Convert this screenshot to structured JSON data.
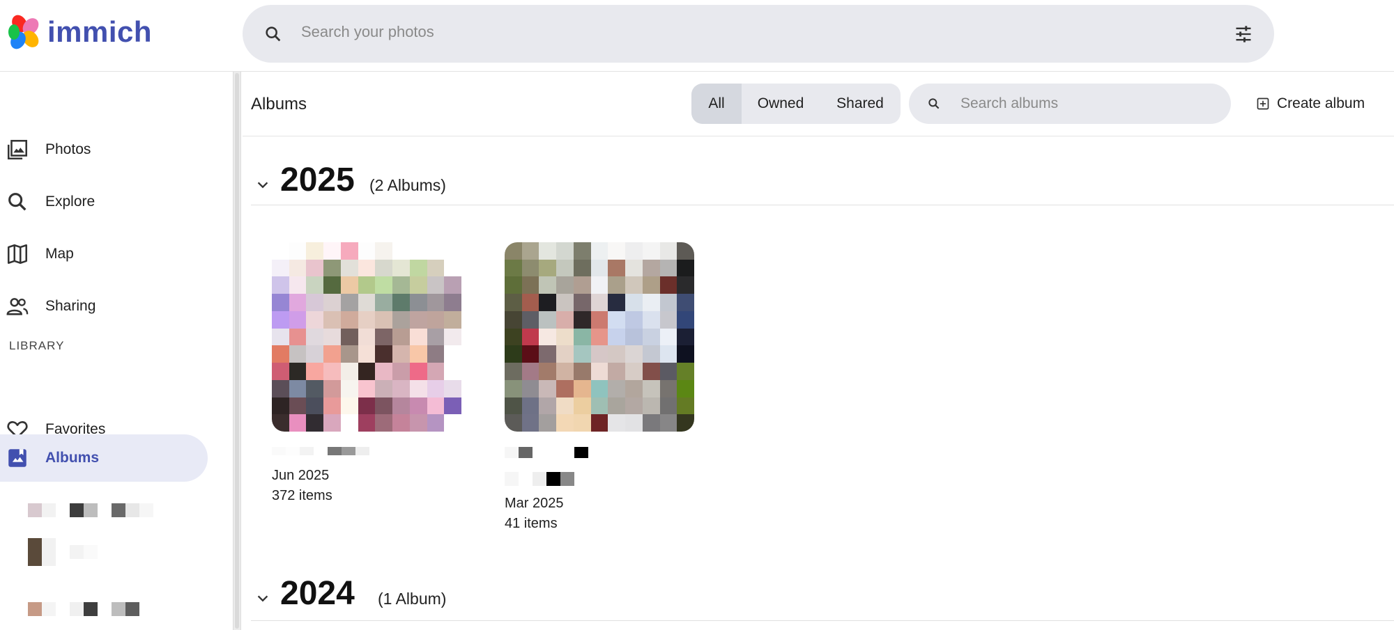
{
  "app": {
    "name": "immich",
    "brand_color": "#4250af"
  },
  "search": {
    "placeholder": "Search your photos"
  },
  "sidebar": {
    "items": [
      {
        "label": "Photos",
        "icon": "photos-icon"
      },
      {
        "label": "Explore",
        "icon": "search-icon"
      },
      {
        "label": "Map",
        "icon": "map-icon"
      },
      {
        "label": "Sharing",
        "icon": "people-icon"
      }
    ],
    "library_heading": "LIBRARY",
    "library_items": [
      {
        "label": "Favorites",
        "icon": "heart-icon"
      },
      {
        "label": "Albums",
        "icon": "album-icon",
        "active": true
      }
    ]
  },
  "albums_page": {
    "title": "Albums",
    "filters": {
      "all": "All",
      "owned": "Owned",
      "shared": "Shared",
      "selected": "All"
    },
    "search_placeholder": "Search albums",
    "create_label": "Create album"
  },
  "groups": [
    {
      "year": "2025",
      "count_label": "(2 Albums)",
      "albums": [
        {
          "date": "Jun 2025",
          "items": "372 items"
        },
        {
          "date": "Mar 2025",
          "items": "41 items"
        }
      ]
    },
    {
      "year": "2024",
      "count_label": "(1 Album)",
      "albums": []
    }
  ]
}
